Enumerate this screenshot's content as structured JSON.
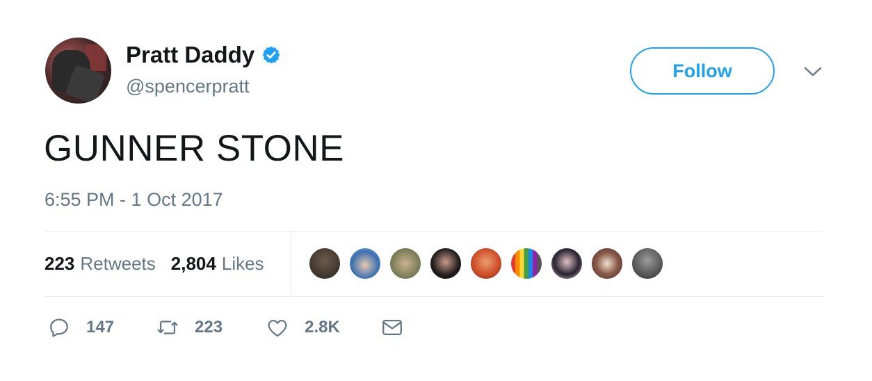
{
  "author": {
    "display_name": "Pratt Daddy",
    "handle": "@spencerpratt",
    "verified": true
  },
  "follow_button": {
    "label": "Follow"
  },
  "tweet": {
    "text": "GUNNER STONE",
    "timestamp": "6:55 PM - 1 Oct 2017"
  },
  "stats": {
    "retweets_count": "223",
    "retweets_label": "Retweets",
    "likes_count": "2,804",
    "likes_label": "Likes"
  },
  "actions": {
    "replies": "147",
    "retweets": "223",
    "likes": "2.8K"
  },
  "colors": {
    "accent": "#1da1f2",
    "secondary_text": "#657786",
    "primary_text": "#14171a",
    "divider": "#e6ecf0"
  }
}
